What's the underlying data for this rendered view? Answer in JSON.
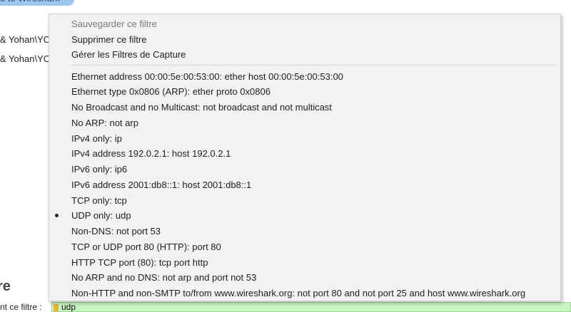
{
  "background": {
    "welcome_banner": "e to Wireshark",
    "lines": [
      "& Yohan\\YO",
      "& Yohan\\YO"
    ],
    "heading": "re",
    "filter_label": "nt ce filtre :",
    "filter_value": "udp"
  },
  "menu": {
    "actions": [
      {
        "label": "Sauvegarder ce filtre",
        "disabled": true
      },
      {
        "label": "Supprimer ce filtre",
        "disabled": false
      },
      {
        "label": "Gérer les Filtres de Capture",
        "disabled": false
      }
    ],
    "filters": [
      {
        "label": "Ethernet address 00:00:5e:00:53:00: ether host 00:00:5e:00:53:00",
        "selected": false
      },
      {
        "label": "Ethernet type 0x0806 (ARP): ether proto 0x0806",
        "selected": false
      },
      {
        "label": "No Broadcast and no Multicast: not broadcast and not multicast",
        "selected": false
      },
      {
        "label": "No ARP: not arp",
        "selected": false
      },
      {
        "label": "IPv4 only: ip",
        "selected": false
      },
      {
        "label": "IPv4 address 192.0.2.1: host 192.0.2.1",
        "selected": false
      },
      {
        "label": "IPv6 only: ip6",
        "selected": false
      },
      {
        "label": "IPv6 address 2001:db8::1: host 2001:db8::1",
        "selected": false
      },
      {
        "label": "TCP only: tcp",
        "selected": false
      },
      {
        "label": "UDP only: udp",
        "selected": true
      },
      {
        "label": "Non-DNS: not port 53",
        "selected": false
      },
      {
        "label": "TCP or UDP port 80 (HTTP): port 80",
        "selected": false
      },
      {
        "label": "HTTP TCP port (80): tcp port http",
        "selected": false
      },
      {
        "label": "No ARP and no DNS: not arp and port not 53",
        "selected": false
      },
      {
        "label": "Non-HTTP and non-SMTP to/from www.wireshark.org: not port 80 and not port 25 and host www.wireshark.org",
        "selected": false
      }
    ]
  }
}
